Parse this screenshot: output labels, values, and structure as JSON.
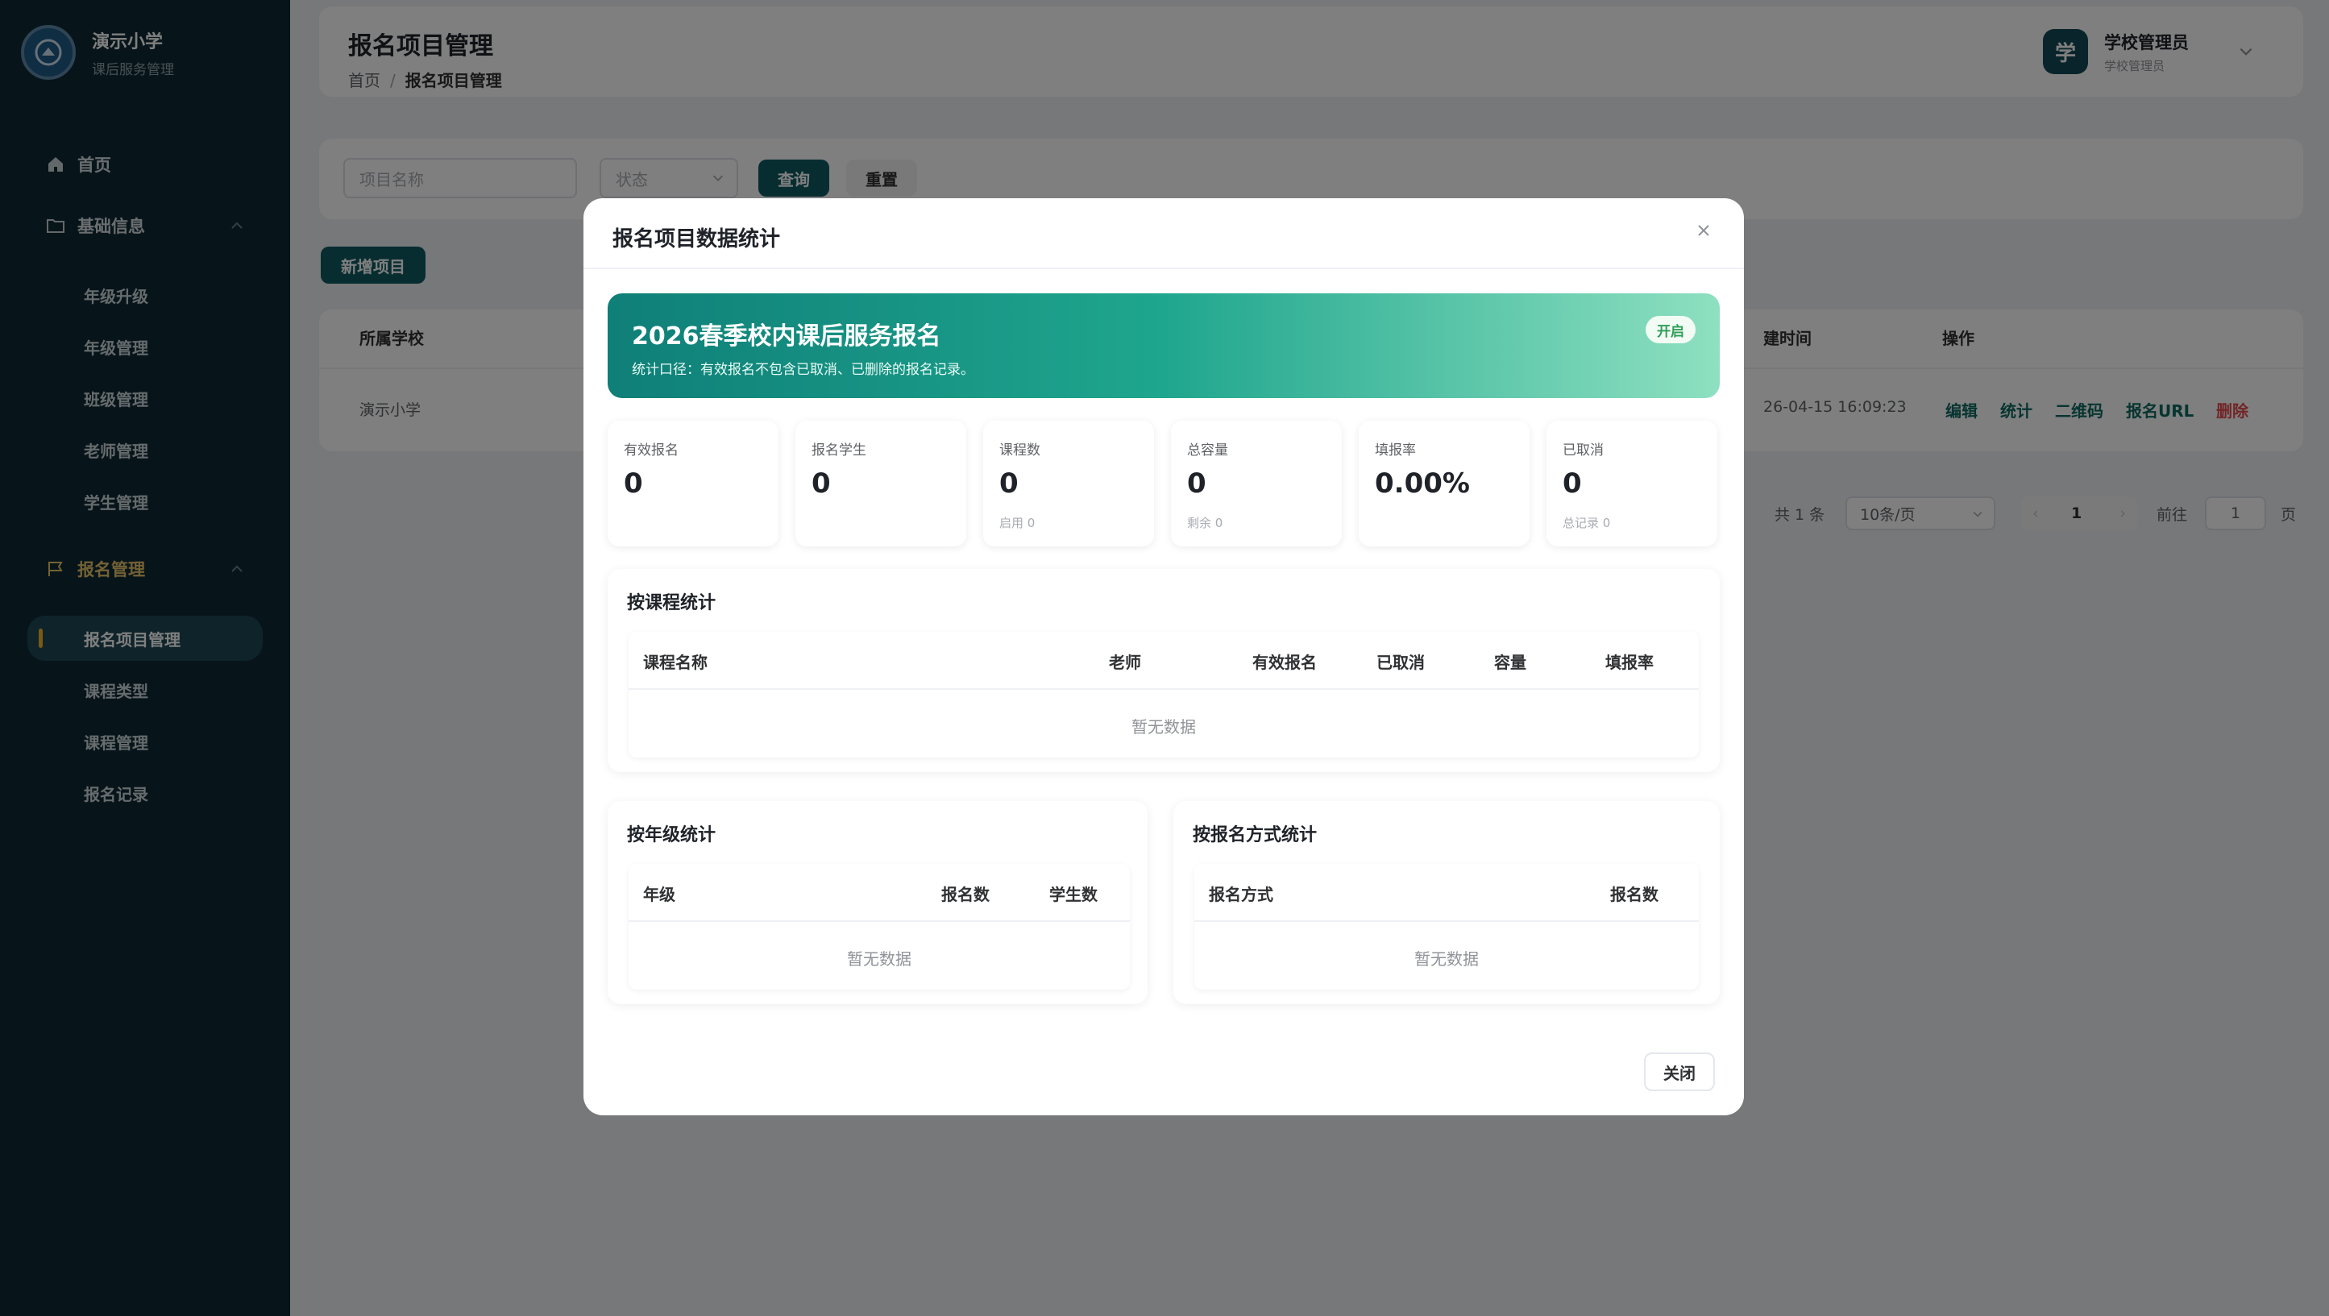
{
  "sidebar": {
    "brand_title": "演示小学",
    "brand_subtitle": "课后服务管理",
    "nav": {
      "home": "首页",
      "basic_info": "基础信息",
      "basic_children": [
        "年级升级",
        "年级管理",
        "班级管理",
        "老师管理",
        "学生管理"
      ],
      "registration": "报名管理",
      "registration_children": [
        "报名项目管理",
        "课程类型",
        "课程管理",
        "报名记录"
      ]
    }
  },
  "header": {
    "title": "报名项目管理",
    "breadcrumb": [
      "首页",
      "报名项目管理"
    ],
    "user_avatar": "学",
    "user_name": "学校管理员",
    "user_role": "学校管理员"
  },
  "filter": {
    "name_placeholder": "项目名称",
    "status_placeholder": "状态",
    "query_label": "查询",
    "reset_label": "重置"
  },
  "toolbar": {
    "add_label": "新增项目"
  },
  "table": {
    "headers": {
      "school": "所属学校",
      "time": "建时间",
      "ops": "操作"
    },
    "row": {
      "school": "演示小学",
      "time": "26-04-15 16:09:23"
    },
    "ops": [
      "编辑",
      "统计",
      "二维码",
      "报名URL",
      "删除"
    ]
  },
  "pager": {
    "total": "共 1 条",
    "size": "10条/页",
    "page": "1",
    "goto": "前往",
    "goto_value": "1",
    "page_suffix": "页"
  },
  "modal": {
    "title": "报名项目数据统计",
    "banner_title": "2026春季校内课后服务报名",
    "banner_note": "统计口径：有效报名不包含已取消、已删除的报名记录。",
    "banner_tag": "开启",
    "stats": [
      {
        "label": "有效报名",
        "value": "0",
        "sub": ""
      },
      {
        "label": "报名学生",
        "value": "0",
        "sub": ""
      },
      {
        "label": "课程数",
        "value": "0",
        "sub": "启用 0"
      },
      {
        "label": "总容量",
        "value": "0",
        "sub": "剩余 0"
      },
      {
        "label": "填报率",
        "value": "0.00%",
        "sub": ""
      },
      {
        "label": "已取消",
        "value": "0",
        "sub": "总记录 0"
      }
    ],
    "course_section": {
      "title": "按课程统计",
      "columns": [
        "课程名称",
        "老师",
        "有效报名",
        "已取消",
        "容量",
        "填报率"
      ],
      "empty": "暂无数据"
    },
    "grade_section": {
      "title": "按年级统计",
      "columns": [
        "年级",
        "报名数",
        "学生数"
      ],
      "empty": "暂无数据"
    },
    "method_section": {
      "title": "按报名方式统计",
      "columns": [
        "报名方式",
        "报名数"
      ],
      "empty": "暂无数据"
    },
    "close_label": "关闭"
  }
}
